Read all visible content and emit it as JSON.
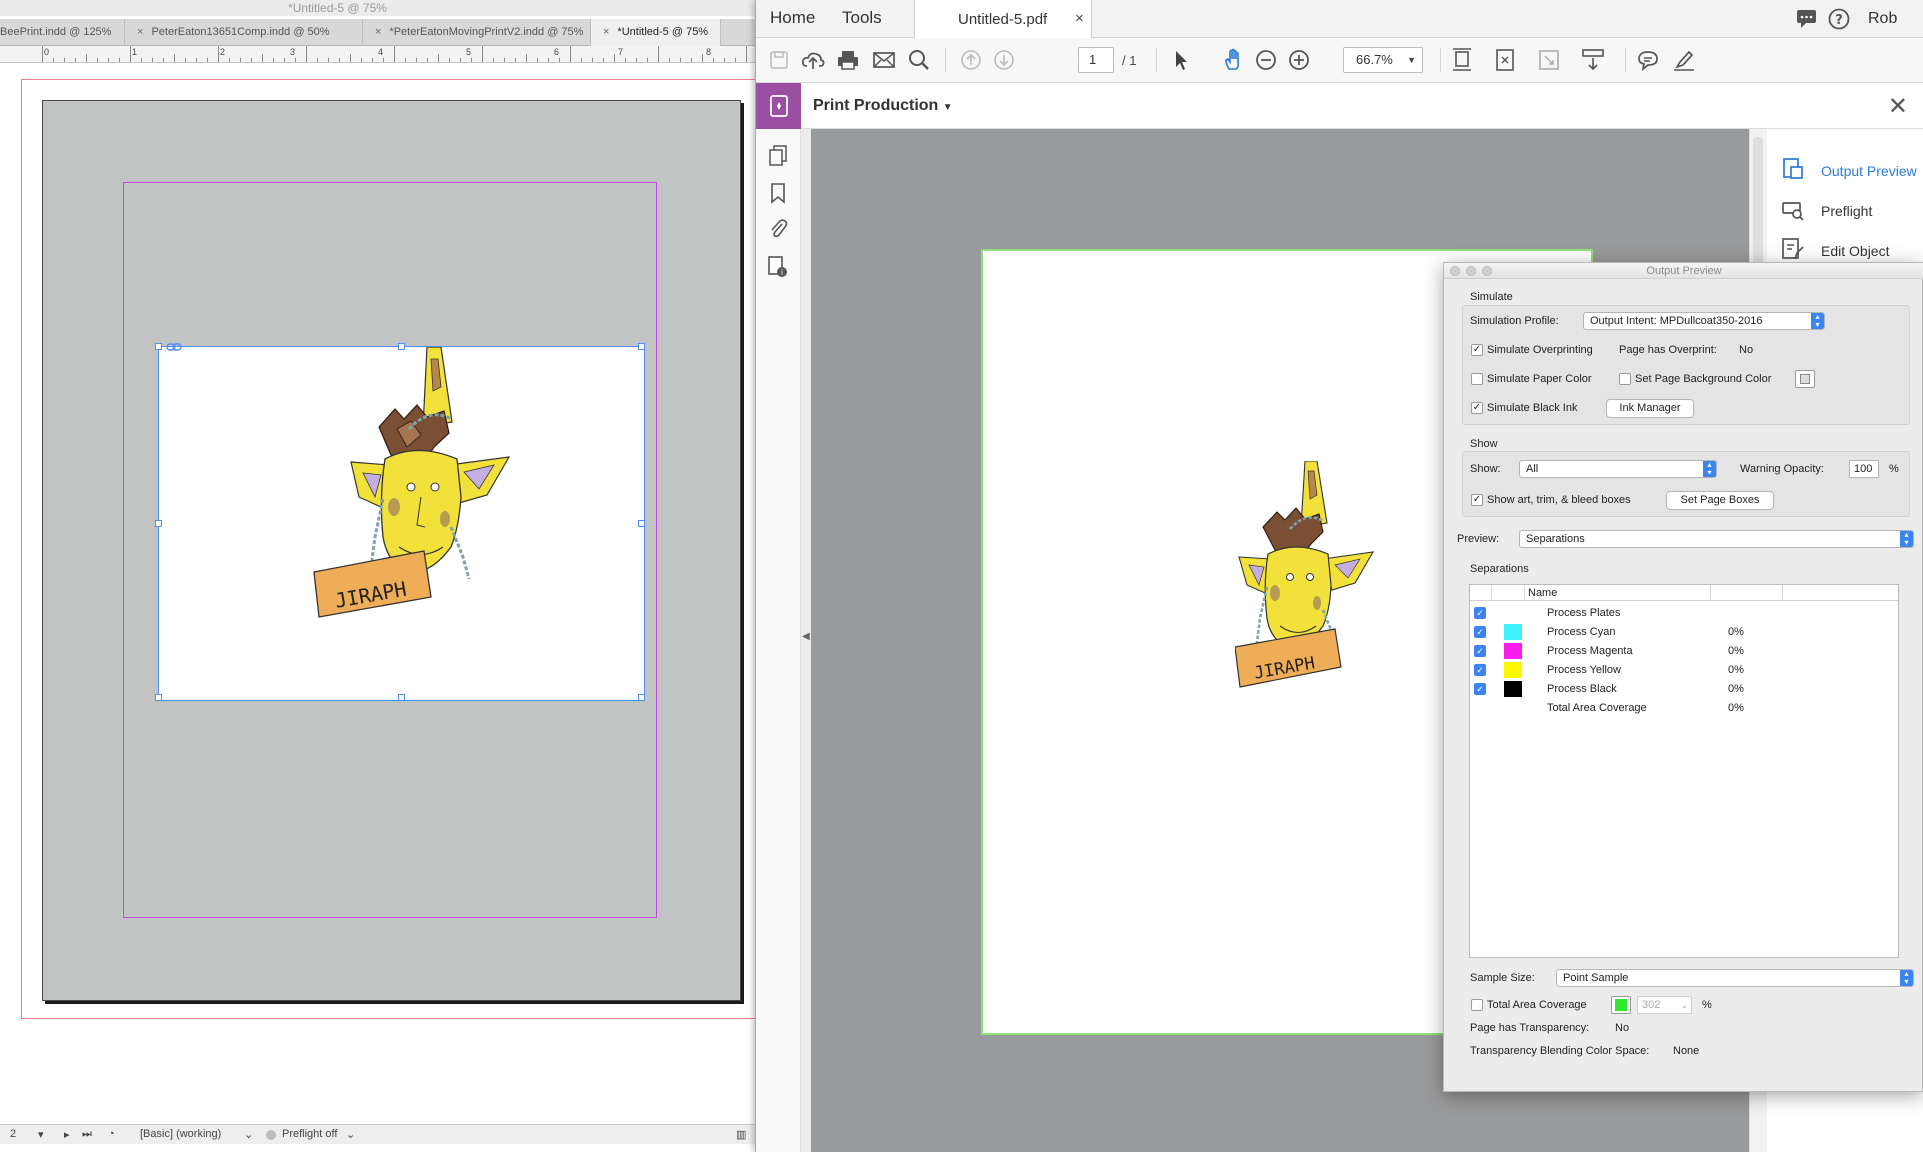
{
  "indesign": {
    "window_title": "*Untitled-5 @ 75%",
    "tabs": [
      {
        "label": "BeePrint.indd @ 125%"
      },
      {
        "label": "PeterEaton13651Comp.indd @ 50%"
      },
      {
        "label": "*PeterEatonMovingPrintV2.indd @ 75%"
      },
      {
        "label": "*Untitled-5 @ 75%"
      }
    ],
    "tab_close_glyph": "×",
    "ruler_labels": [
      "0",
      "1",
      "2",
      "3",
      "4",
      "5",
      "6",
      "7",
      "8"
    ],
    "artwork_sign_text": "JIRAPH",
    "status": {
      "page_field": "2",
      "workspace_profile": "[Basic] (working)",
      "preflight": "Preflight off"
    }
  },
  "acrobat": {
    "nav": {
      "home": "Home",
      "tools": "Tools",
      "user": "Rob"
    },
    "document_tab": {
      "label": "Untitled-5.pdf",
      "close_glyph": "×"
    },
    "toolbar": {
      "page_current": "1",
      "page_total": "/ 1",
      "zoom": "66.7%"
    },
    "panel": {
      "title": "Print Production",
      "close_glyph": "✕"
    },
    "artwork_sign_text": "JIRAPH",
    "right_panel": {
      "items": [
        {
          "label": "Output Preview"
        },
        {
          "label": "Preflight"
        },
        {
          "label": "Edit Object"
        }
      ]
    },
    "output_preview": {
      "title": "Output Preview",
      "simulate": {
        "section_label": "Simulate",
        "profile_label": "Simulation Profile:",
        "profile_value": "Output Intent: MPDullcoat350-2016",
        "simulate_overprinting": "Simulate Overprinting",
        "page_has_overprint_label": "Page has Overprint:",
        "page_has_overprint_value": "No",
        "simulate_paper_color": "Simulate Paper Color",
        "set_page_background": "Set Page Background Color",
        "simulate_black_ink": "Simulate Black Ink",
        "ink_manager": "Ink Manager"
      },
      "show": {
        "section_label": "Show",
        "show_label": "Show:",
        "show_value": "All",
        "warning_opacity_label": "Warning Opacity:",
        "warning_opacity_value": "100",
        "percent": "%",
        "show_boxes": "Show art, trim, & bleed boxes",
        "set_page_boxes": "Set Page Boxes"
      },
      "preview": {
        "label": "Preview:",
        "value": "Separations"
      },
      "separations": {
        "section_label": "Separations",
        "column_name": "Name",
        "rows": [
          {
            "name": "Process Plates",
            "percent": "",
            "color": ""
          },
          {
            "name": "Process Cyan",
            "percent": "0%",
            "color": "#40f2ff"
          },
          {
            "name": "Process Magenta",
            "percent": "0%",
            "color": "#f81ef2"
          },
          {
            "name": "Process Yellow",
            "percent": "0%",
            "color": "#fbf800"
          },
          {
            "name": "Process Black",
            "percent": "0%",
            "color": "#000000"
          },
          {
            "name": "Total Area Coverage",
            "percent": "0%",
            "color": ""
          }
        ]
      },
      "sample_size": {
        "label": "Sample Size:",
        "value": "Point Sample"
      },
      "total_area_coverage": {
        "label": "Total Area Coverage",
        "value": "302",
        "percent": "%",
        "swatch_color": "#2ee82a"
      },
      "transparency": {
        "label": "Page has Transparency:",
        "value": "No"
      },
      "blending": {
        "label": "Transparency Blending Color Space:",
        "value": "None"
      }
    }
  }
}
